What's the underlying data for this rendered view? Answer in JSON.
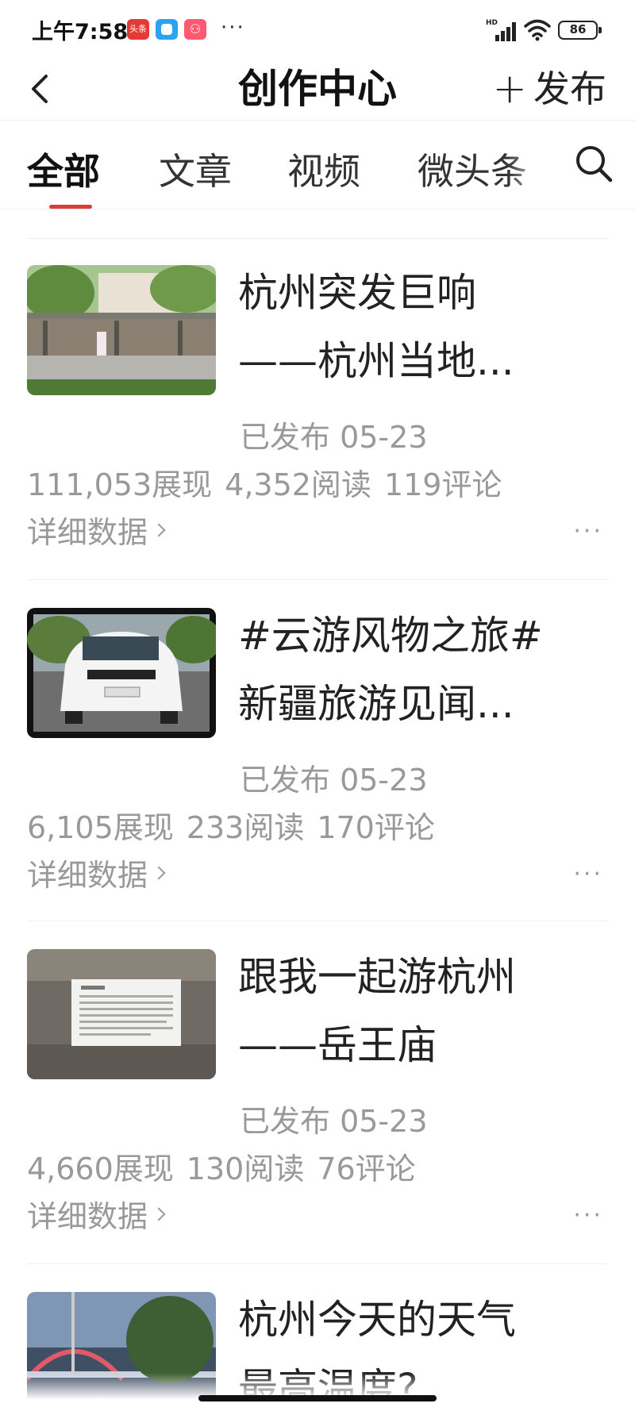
{
  "status_bar": {
    "time": "上午7:58",
    "app_badge": "头条",
    "more": "···",
    "signal": "HD",
    "battery": "86"
  },
  "header": {
    "title": "创作中心",
    "publish_label": "发布"
  },
  "tabs": [
    {
      "label": "全部"
    },
    {
      "label": "文章"
    },
    {
      "label": "视频"
    },
    {
      "label": "微头条"
    }
  ],
  "articles": [
    {
      "title_line1": "杭州突发巨响",
      "title_line2": "——杭州当地...",
      "status": "已发布  05-23",
      "impressions": "111,053展现",
      "reads": "4,352阅读",
      "comments": "119评论",
      "detail": "详细数据",
      "more": "···"
    },
    {
      "title_line1": "#云游风物之旅#",
      "title_line2": "新疆旅游见闻...",
      "status": "已发布  05-23",
      "impressions": "6,105展现",
      "reads": "233阅读",
      "comments": "170评论",
      "detail": "详细数据",
      "more": "···"
    },
    {
      "title_line1": "跟我一起游杭州",
      "title_line2": "——岳王庙",
      "status": "已发布  05-23",
      "impressions": "4,660展现",
      "reads": "130阅读",
      "comments": "76评论",
      "detail": "详细数据",
      "more": "···"
    },
    {
      "title_line1": "杭州今天的天气",
      "title_line2": "最高温度?"
    }
  ],
  "colors": {
    "accent": "#e03b3b",
    "muted_text": "#999999"
  }
}
